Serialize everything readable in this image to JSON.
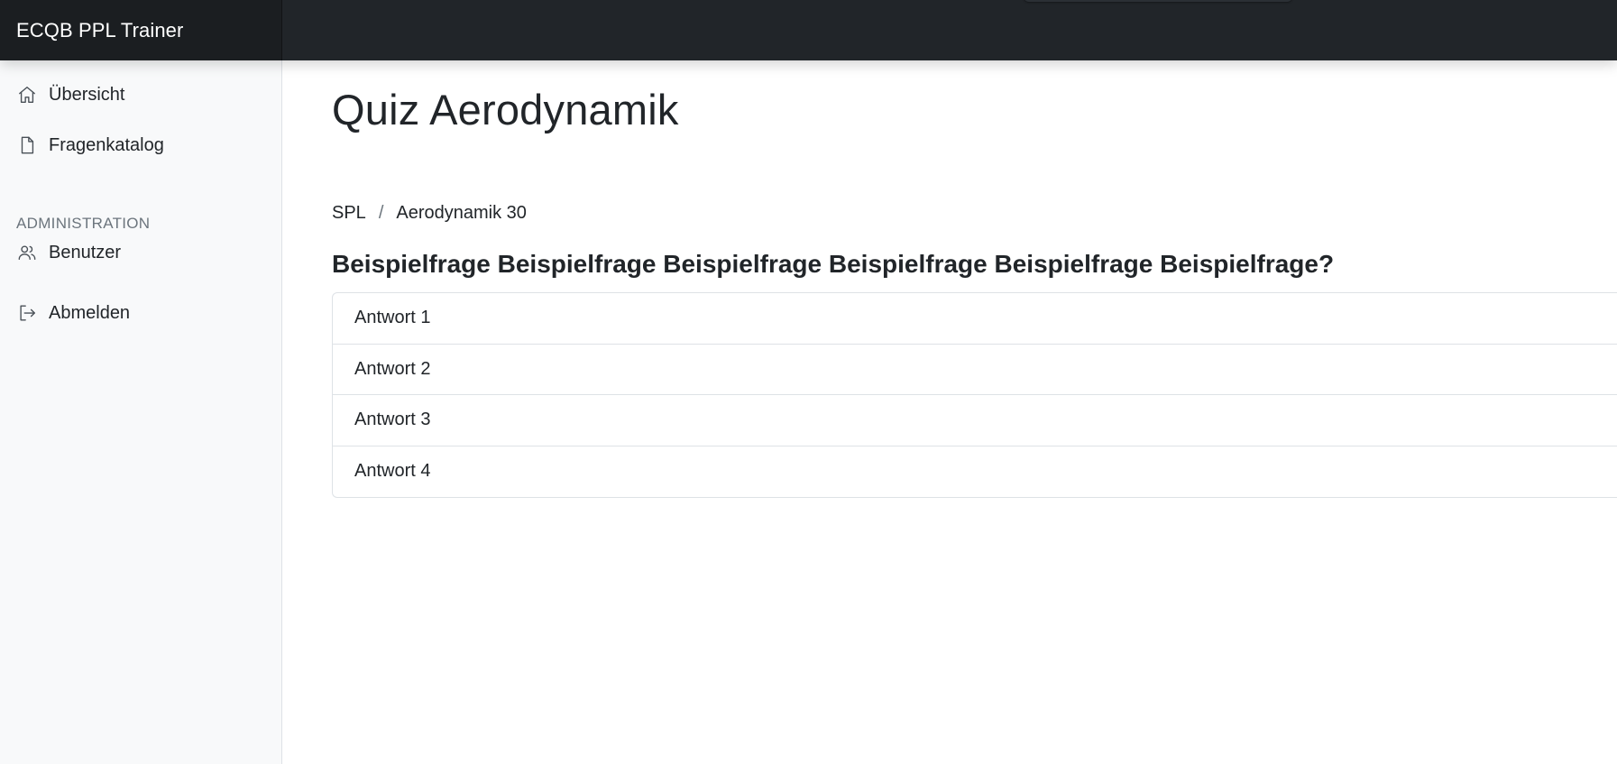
{
  "app": {
    "brand": "ECQB PPL Trainer"
  },
  "sidebar": {
    "items": [
      {
        "label": "Übersicht",
        "icon": "home-icon"
      },
      {
        "label": "Fragenkatalog",
        "icon": "document-icon"
      }
    ],
    "admin_heading": "ADMINISTRATION",
    "admin_items": [
      {
        "label": "Benutzer",
        "icon": "users-icon"
      }
    ],
    "logout": {
      "label": "Abmelden",
      "icon": "logout-icon"
    }
  },
  "main": {
    "title": "Quiz Aerodynamik",
    "breadcrumb": {
      "items": [
        "SPL",
        "Aerodynamik 30"
      ],
      "separator": "/"
    },
    "question": "Beispielfrage Beispielfrage Beispielfrage Beispielfrage Beispielfrage Beispielfrage?",
    "answers": [
      "Antwort 1",
      "Antwort 2",
      "Antwort 3",
      "Antwort 4"
    ]
  },
  "colors": {
    "topbar": "#212529",
    "sidebar_bg": "#f8f9fa",
    "text": "#212529",
    "muted": "#6c757d",
    "border": "#dee2e6"
  }
}
